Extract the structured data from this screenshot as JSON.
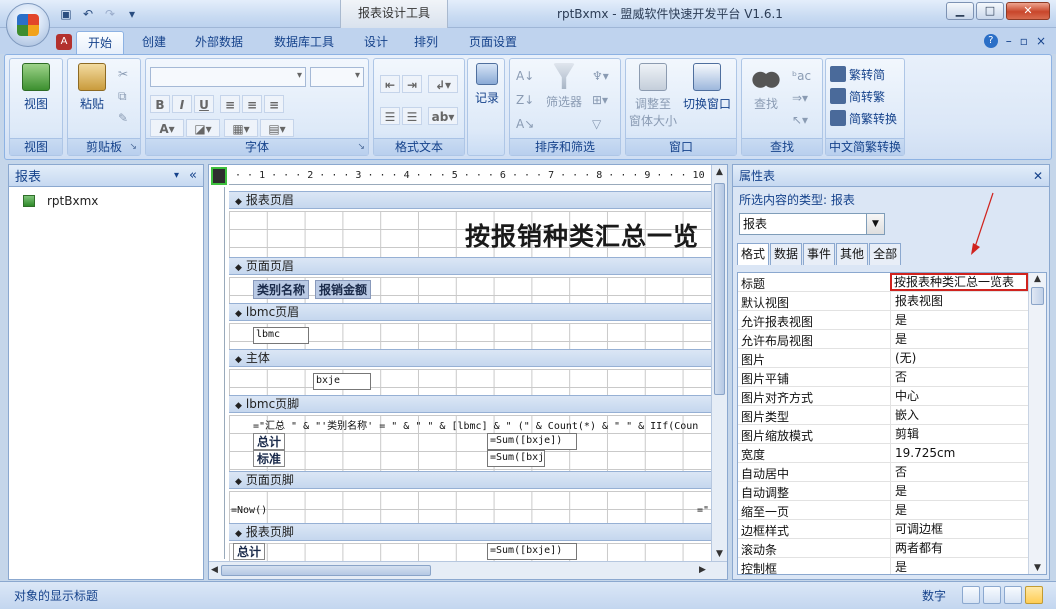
{
  "window": {
    "app_title": "rptBxmx - 盟威软件快速开发平台 V1.6.1",
    "contextual_tab_title": "报表设计工具",
    "controls": [
      "▁",
      "□",
      "✕"
    ]
  },
  "ribbon": {
    "tabs": [
      "开始",
      "创建",
      "外部数据",
      "数据库工具",
      "设计",
      "排列",
      "页面设置"
    ],
    "active_tab": "开始",
    "help_icon": "help-icon",
    "right_controls": [
      "?",
      "–",
      "▫",
      "×"
    ],
    "groups": {
      "views": {
        "label": "视图",
        "btn": "视图"
      },
      "clipboard": {
        "label": "剪贴板",
        "paste": "粘贴"
      },
      "font": {
        "label": "字体"
      },
      "rich_text": {
        "label": "格式文本"
      },
      "records": {
        "label": "记录",
        "btn": "记录"
      },
      "sort_filter": {
        "label": "排序和筛选",
        "filter": "筛选器"
      },
      "window": {
        "label": "窗口",
        "fit": "调整至",
        "fit2": "窗体大小",
        "switch": "切换窗口"
      },
      "find": {
        "label": "查找",
        "btn": "查找"
      },
      "conv": {
        "label": "中文简繁转换",
        "t2s": "繁转简",
        "s2t": "简转繁",
        "conv": "简繁转换"
      }
    }
  },
  "nav": {
    "title": "报表",
    "items": [
      {
        "label": "rptBxmx"
      }
    ]
  },
  "design": {
    "ruler": "· · 1 · · · 2 · · · 3 · · · 4 · · · 5 · · · 6 · · · 7 · · · 8 · · · 9 · · · 10 · · 11 · · 12 ·",
    "sections": {
      "report_header": "报表页眉",
      "page_header": "页面页眉",
      "group_header": "lbmc页眉",
      "detail": "主体",
      "group_footer": "lbmc页脚",
      "page_footer": "页面页脚",
      "report_footer": "报表页脚"
    },
    "controls": {
      "report_title": "按报销种类汇总一览",
      "lbl_category": "类别名称",
      "lbl_amount": "报销金额",
      "txt_lbmc": "lbmc",
      "txt_bxje": "bxje",
      "group_expr": "=\"汇总 \" & \"'类别名称' = \" & \" \" & [lbmc] & \" (\" & Count(*) & \" \" & IIf(Coun",
      "lbl_total": "总计",
      "lbl_std": "标准",
      "sum1": "=Sum([bxje])",
      "sum2": "=Sum([bxj",
      "now": "=Now()",
      "page_expr": "=\"",
      "rf_total": "总计",
      "rf_sum": "=Sum([bxje])"
    }
  },
  "props": {
    "title": "属性表",
    "selection_type": "所选内容的类型: 报表",
    "object": "报表",
    "tabs": [
      "格式",
      "数据",
      "事件",
      "其他",
      "全部"
    ],
    "active_tab": "格式",
    "rows": [
      {
        "name": "标题",
        "value": "按报表种类汇总一览表"
      },
      {
        "name": "默认视图",
        "value": "报表视图"
      },
      {
        "name": "允许报表视图",
        "value": "是"
      },
      {
        "name": "允许布局视图",
        "value": "是"
      },
      {
        "name": "图片",
        "value": "(无)"
      },
      {
        "name": "图片平铺",
        "value": "否"
      },
      {
        "name": "图片对齐方式",
        "value": "中心"
      },
      {
        "name": "图片类型",
        "value": "嵌入"
      },
      {
        "name": "图片缩放模式",
        "value": "剪辑"
      },
      {
        "name": "宽度",
        "value": "19.725cm"
      },
      {
        "name": "自动居中",
        "value": "否"
      },
      {
        "name": "自动调整",
        "value": "是"
      },
      {
        "name": "缩至一页",
        "value": "是"
      },
      {
        "name": "边框样式",
        "value": "可调边框"
      },
      {
        "name": "滚动条",
        "value": "两者都有"
      },
      {
        "name": "控制框",
        "value": "是"
      }
    ],
    "highlight_color": "#d0231e"
  },
  "status": {
    "text": "对象的显示标题",
    "mode": "数字"
  }
}
